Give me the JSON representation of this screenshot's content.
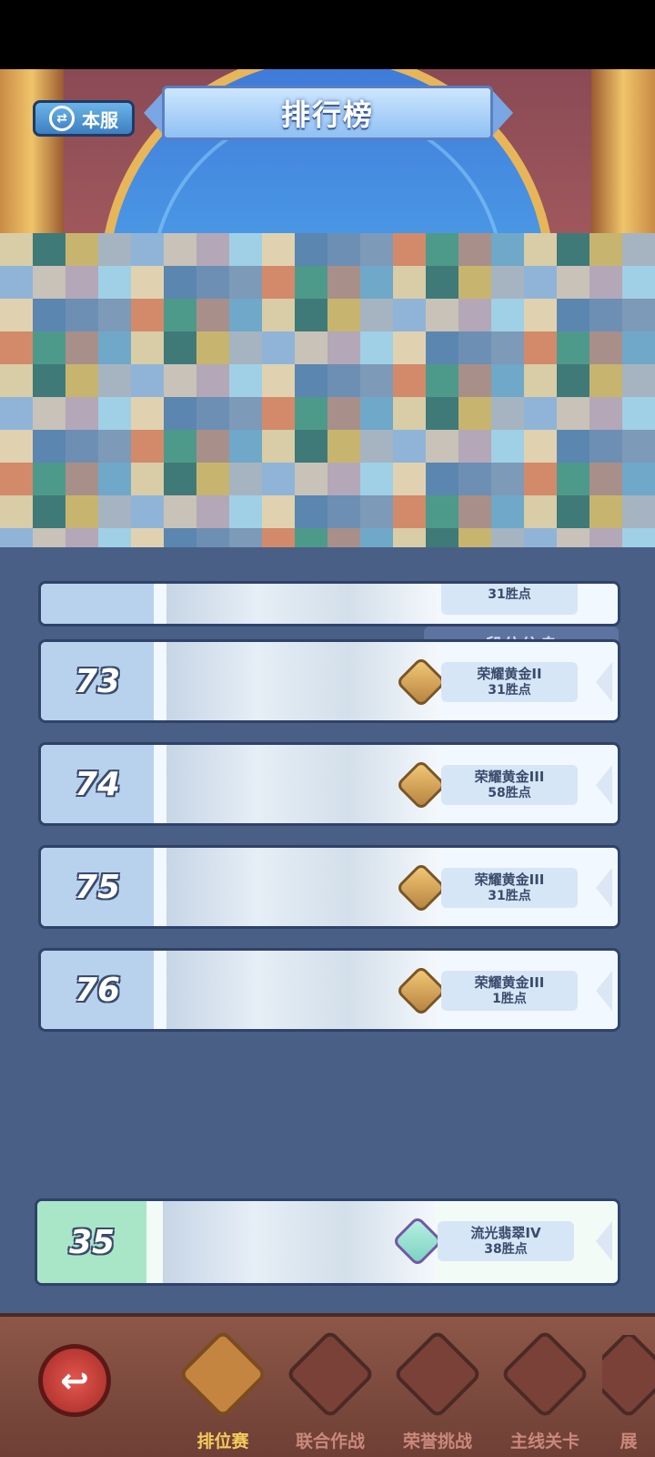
{
  "header": {
    "title": "排行榜",
    "server_button": "本服"
  },
  "tabs": {
    "rank_info": "段位信息"
  },
  "leaderboard": [
    {
      "rank": "73",
      "tier": "荣耀黄金II",
      "points": "31胜点"
    },
    {
      "rank": "74",
      "tier": "荣耀黄金III",
      "points": "58胜点"
    },
    {
      "rank": "75",
      "tier": "荣耀黄金III",
      "points": "31胜点"
    },
    {
      "rank": "76",
      "tier": "荣耀黄金III",
      "points": "1胜点"
    }
  ],
  "partial_row": {
    "points": "31胜点"
  },
  "my_rank": {
    "rank": "35",
    "tier": "流光翡翠IV",
    "points": "38胜点"
  },
  "bottom_nav": [
    {
      "label": "排位赛",
      "active": true
    },
    {
      "label": "联合作战",
      "active": false
    },
    {
      "label": "荣誉挑战",
      "active": false
    },
    {
      "label": "主线关卡",
      "active": false
    },
    {
      "label": "展",
      "active": false
    }
  ],
  "colors": {
    "panel_bg": "#4a5f86",
    "row_bg": "#f2f8ff",
    "my_row_bg": "#a9e6c7",
    "nav_active": "#f4cb5b"
  }
}
